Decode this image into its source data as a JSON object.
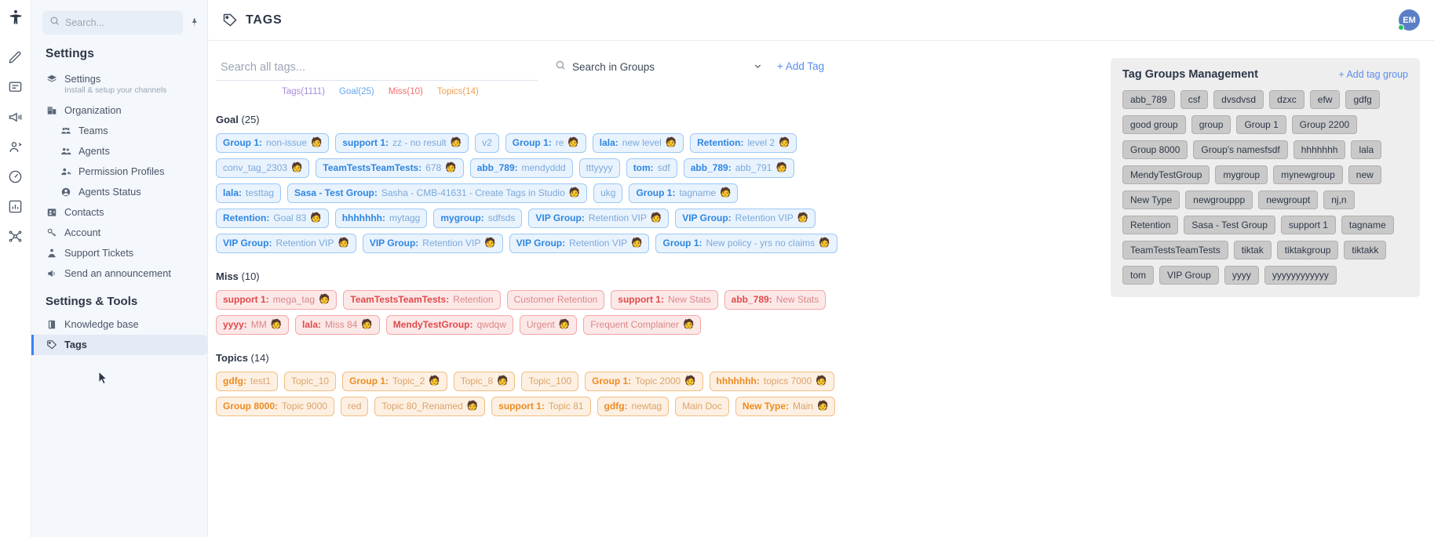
{
  "rail": {
    "logo_icon": "app-logo-icon",
    "items": [
      {
        "icon": "pencil-icon"
      },
      {
        "icon": "chat-bubble-icon"
      },
      {
        "icon": "megaphone-icon"
      },
      {
        "icon": "contacts-icon"
      },
      {
        "icon": "gauge-icon"
      },
      {
        "icon": "bar-chart-icon"
      },
      {
        "icon": "network-icon"
      }
    ]
  },
  "sidebar": {
    "search_placeholder": "Search...",
    "search_icon": "search-icon",
    "pin_icon": "pin-icon",
    "title": "Settings",
    "section_title": "Settings & Tools",
    "items": [
      {
        "label": "Settings",
        "sub": "Install & setup your channels",
        "icon": "layers-icon"
      },
      {
        "label": "Organization",
        "sub": "",
        "icon": "building-icon"
      },
      {
        "label": "Teams",
        "sub": "",
        "icon": "teams-icon"
      },
      {
        "label": "Agents",
        "sub": "",
        "icon": "agents-icon"
      },
      {
        "label": "Permission Profiles",
        "sub": "",
        "icon": "permission-icon"
      },
      {
        "label": "Agents Status",
        "sub": "",
        "icon": "agent-status-icon"
      },
      {
        "label": "Contacts",
        "sub": "",
        "icon": "contact-card-icon"
      },
      {
        "label": "Account",
        "sub": "",
        "icon": "key-icon"
      },
      {
        "label": "Support Tickets",
        "sub": "",
        "icon": "ticket-icon"
      },
      {
        "label": "Send an announcement",
        "sub": "",
        "icon": "announce-icon"
      }
    ],
    "tools_items": [
      {
        "label": "Knowledge base",
        "icon": "book-icon"
      },
      {
        "label": "Tags",
        "icon": "tag-icon"
      }
    ]
  },
  "header": {
    "title": "TAGS",
    "title_icon": "tag-icon",
    "avatar_initials": "EM",
    "status_color": "#22c55e"
  },
  "search": {
    "all_tags_placeholder": "Search all tags...",
    "all_tags_value": "",
    "groups_icon": "search-icon",
    "groups_label": "Search in Groups",
    "chevron_icon": "chevron-down-icon",
    "add_tag_label": "+ Add Tag"
  },
  "filters": [
    {
      "label": "Tags(1111)",
      "class": "f-tags"
    },
    {
      "label": "Goal(25)",
      "class": "f-goal"
    },
    {
      "label": "Miss(10)",
      "class": "f-miss"
    },
    {
      "label": "Topics(14)",
      "class": "f-topics"
    }
  ],
  "sections": [
    {
      "name": "Goal",
      "count": "(25)",
      "chip_class": "c-goal",
      "tags": [
        {
          "group": "Group 1:",
          "name": "non-issue",
          "emoji": "🧑"
        },
        {
          "group": "support 1:",
          "name": "zz - no result",
          "emoji": "🧑"
        },
        {
          "group": "",
          "name": "v2",
          "emoji": ""
        },
        {
          "group": "Group 1:",
          "name": "re",
          "emoji": "🧑"
        },
        {
          "group": "lala:",
          "name": "new level",
          "emoji": "🧑"
        },
        {
          "group": "Retention:",
          "name": "level 2",
          "emoji": "🧑"
        },
        {
          "group": "",
          "name": "conv_tag_2303",
          "emoji": "🧑"
        },
        {
          "group": "TeamTestsTeamTests:",
          "name": "678",
          "emoji": "🧑"
        },
        {
          "group": "abb_789:",
          "name": "mendyddd",
          "emoji": ""
        },
        {
          "group": "",
          "name": "tttyyyy",
          "emoji": ""
        },
        {
          "group": "tom:",
          "name": "sdf",
          "emoji": ""
        },
        {
          "group": "abb_789:",
          "name": "abb_791",
          "emoji": "🧑"
        },
        {
          "group": "lala:",
          "name": "testtag",
          "emoji": ""
        },
        {
          "group": "Sasa - Test Group:",
          "name": "Sasha - CMB-41631 - Create Tags in Studio",
          "emoji": "🧑"
        },
        {
          "group": "",
          "name": "ukg",
          "emoji": ""
        },
        {
          "group": "Group 1:",
          "name": "tagname",
          "emoji": "🧑"
        },
        {
          "group": "Retention:",
          "name": "Goal 83",
          "emoji": "🧑"
        },
        {
          "group": "hhhhhhh:",
          "name": "mytagg",
          "emoji": ""
        },
        {
          "group": "mygroup:",
          "name": "sdfsds",
          "emoji": ""
        },
        {
          "group": "VIP Group:",
          "name": "Retention VIP",
          "emoji": "🧑"
        },
        {
          "group": "VIP Group:",
          "name": "Retention VIP",
          "emoji": "🧑"
        },
        {
          "group": "VIP Group:",
          "name": "Retention VIP",
          "emoji": "🧑"
        },
        {
          "group": "VIP Group:",
          "name": "Retention VIP",
          "emoji": "🧑"
        },
        {
          "group": "VIP Group:",
          "name": "Retention VIP",
          "emoji": "🧑"
        },
        {
          "group": "Group 1:",
          "name": "New policy - yrs no claims",
          "emoji": "🧑"
        }
      ]
    },
    {
      "name": "Miss",
      "count": "(10)",
      "chip_class": "c-miss",
      "tags": [
        {
          "group": "support 1:",
          "name": "mega_tag",
          "emoji": "🧑"
        },
        {
          "group": "TeamTestsTeamTests:",
          "name": "Retention",
          "emoji": ""
        },
        {
          "group": "",
          "name": "Customer Retention",
          "emoji": ""
        },
        {
          "group": "support 1:",
          "name": "New Stats",
          "emoji": ""
        },
        {
          "group": "abb_789:",
          "name": "New Stats",
          "emoji": ""
        },
        {
          "group": "yyyy:",
          "name": "MM",
          "emoji": "🧑"
        },
        {
          "group": "lala:",
          "name": "Miss 84",
          "emoji": "🧑"
        },
        {
          "group": "MendyTestGroup:",
          "name": "qwdqw",
          "emoji": ""
        },
        {
          "group": "",
          "name": "Urgent",
          "emoji": "🧑"
        },
        {
          "group": "",
          "name": "Frequent Complainer",
          "emoji": "🧑"
        }
      ]
    },
    {
      "name": "Topics",
      "count": "(14)",
      "chip_class": "c-topics",
      "tags": [
        {
          "group": "gdfg:",
          "name": "test1",
          "emoji": ""
        },
        {
          "group": "",
          "name": "Topic_10",
          "emoji": ""
        },
        {
          "group": "Group 1:",
          "name": "Topic_2",
          "emoji": "🧑"
        },
        {
          "group": "",
          "name": "Topic_8",
          "emoji": "🧑"
        },
        {
          "group": "",
          "name": "Topic_100",
          "emoji": ""
        },
        {
          "group": "Group 1:",
          "name": "Topic 2000",
          "emoji": "🧑"
        },
        {
          "group": "hhhhhhh:",
          "name": "topics 7000",
          "emoji": "🧑"
        },
        {
          "group": "Group 8000:",
          "name": "Topic 9000",
          "emoji": ""
        },
        {
          "group": "",
          "name": "red",
          "emoji": ""
        },
        {
          "group": "",
          "name": "Topic 80_Renamed",
          "emoji": "🧑"
        },
        {
          "group": "support 1:",
          "name": "Topic 81",
          "emoji": ""
        },
        {
          "group": "gdfg:",
          "name": "newtag",
          "emoji": ""
        },
        {
          "group": "",
          "name": "Main Doc",
          "emoji": ""
        },
        {
          "group": "New Type:",
          "name": "Main",
          "emoji": "🧑"
        }
      ]
    }
  ],
  "tag_groups": {
    "title": "Tag Groups Management",
    "add_label": "+ Add tag group",
    "groups": [
      "abb_789",
      "csf",
      "dvsdvsd",
      "dzxc",
      "efw",
      "gdfg",
      "good group",
      "group",
      "Group 1",
      "Group 2200",
      "Group 8000",
      "Group's namesfsdf",
      "hhhhhhh",
      "lala",
      "MendyTestGroup",
      "mygroup",
      "mynewgroup",
      "new",
      "New Type",
      "newgrouppp",
      "newgroupt",
      "nj,n",
      "Retention",
      "Sasa - Test Group",
      "support 1",
      "tagname",
      "TeamTestsTeamTests",
      "tiktak",
      "tiktakgroup",
      "tiktakk",
      "tom",
      "VIP Group",
      "yyyy",
      "yyyyyyyyyyyy"
    ]
  },
  "colors": {
    "goal": "#2e86e0",
    "miss": "#e04a4a",
    "topics": "#ec8b22",
    "accent": "#5b8def",
    "sidebar_bg": "#f4f7fb"
  }
}
